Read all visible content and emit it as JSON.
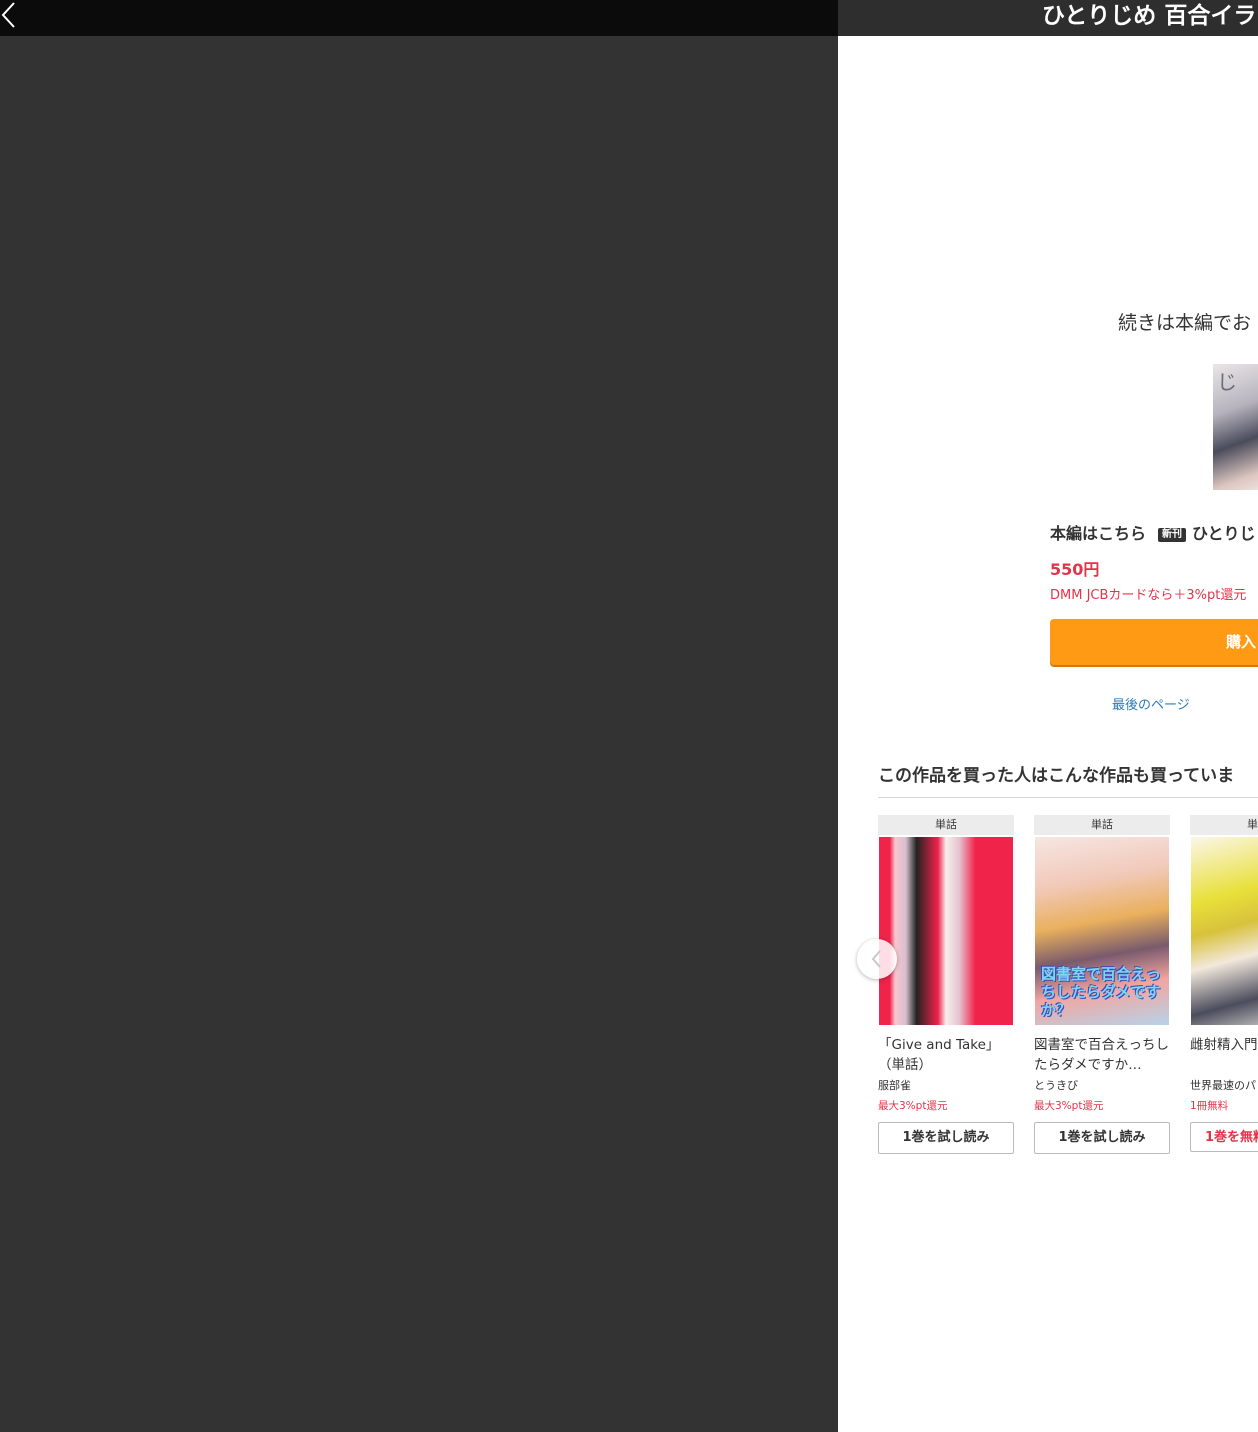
{
  "viewer": {
    "back_icon": "chevron-left-icon"
  },
  "panel": {
    "title": "ひとりじめ 百合イラ",
    "continue_text": "続きは本編でお",
    "cover_kana": "じ",
    "main_label": "本編はこちら",
    "new_badge": "新刊",
    "work_title": "ひとりじ",
    "price": "550円",
    "point_note": "DMM JCBカードなら＋3%pt還元",
    "buy_label": "購入",
    "last_page_link": "最後のページ"
  },
  "recommend": {
    "heading": "この作品を買った人はこんな作品も買っていま",
    "prev_icon": "chevron-left-icon",
    "items": [
      {
        "type": "単話",
        "title": "「Give and Take」（単話）",
        "author": "服部雀",
        "offer": "最大3%pt還元",
        "button": "1巻を試し読み",
        "cover_overlay": ""
      },
      {
        "type": "単話",
        "title": "図書室で百合えっちしたらダメですか…",
        "author": "とうきび",
        "offer": "最大3%pt還元",
        "button": "1巻を試し読み",
        "cover_overlay": "図書室で百合えっちしたらダメですか？"
      },
      {
        "type": "単行",
        "title": "雌射精入門修正版】",
        "author": "世界最速のパ",
        "offer": "1冊無料",
        "button": "1巻を無料",
        "cover_overlay": ""
      }
    ]
  },
  "colors": {
    "accent_orange": "#ff9a15",
    "price_red": "#e2344a",
    "link_blue": "#2a7ab8",
    "viewer_bg": "#333333"
  }
}
